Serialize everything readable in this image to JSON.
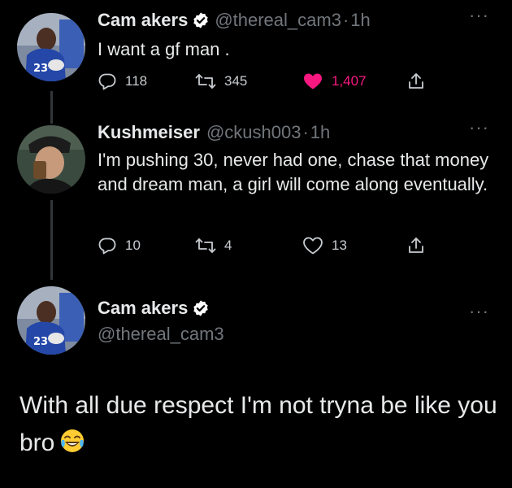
{
  "tweets": [
    {
      "name": "Cam akers",
      "verified": true,
      "handle": "@thereal_cam3",
      "separator": "·",
      "time": "1h",
      "more": "···",
      "text": "I want a gf man .",
      "reply_count": "118",
      "retweet_count": "345",
      "like_count": "1,407",
      "liked": true
    },
    {
      "name": "Kushmeiser",
      "handle": "@ckush003",
      "separator": "·",
      "time": "1h",
      "more": "···",
      "text": "I'm pushing 30, never had one, chase that money and dream man, a girl will come along eventually.",
      "reply_count": "10",
      "retweet_count": "4",
      "like_count": "13",
      "liked": false
    },
    {
      "name": "Cam akers",
      "verified": true,
      "handle": "@thereal_cam3",
      "more": "···",
      "text": "With all due respect I'm not tryna be like you bro",
      "emoji": "face-with-tears-of-joy"
    }
  ],
  "colors": {
    "background": "#000000",
    "text": "#e7e9ea",
    "muted": "#71767b",
    "like": "#f91880",
    "verified_badge": "#ffffff",
    "thread_line": "#333639"
  },
  "icons": [
    "verified-badge-icon",
    "reply-icon",
    "retweet-icon",
    "like-icon",
    "share-icon",
    "more-icon",
    "laughing-emoji-icon"
  ]
}
